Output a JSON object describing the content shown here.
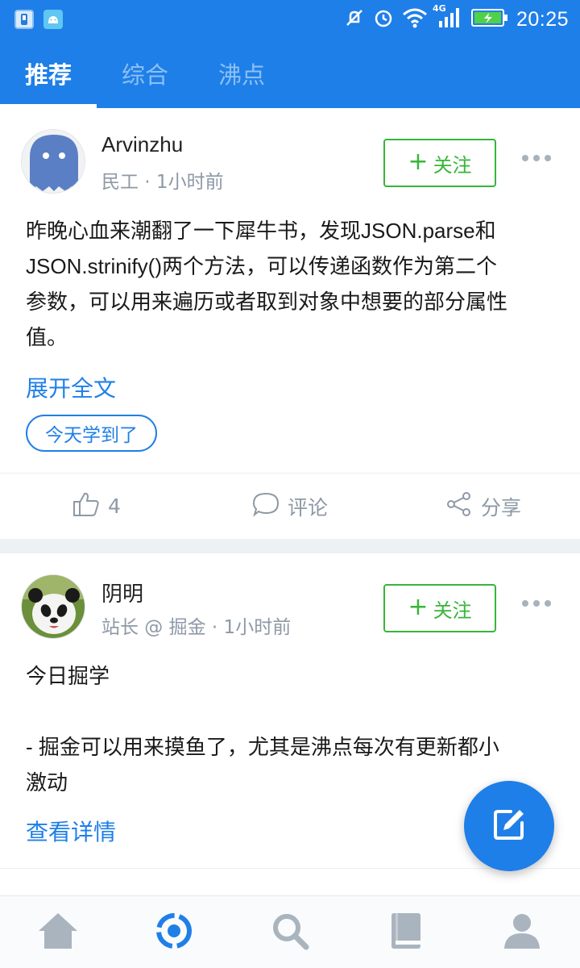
{
  "status_bar": {
    "time": "20:25",
    "network": "4G",
    "icons": [
      "app-icon",
      "android-icon",
      "silent-icon",
      "alarm-icon",
      "wifi-icon",
      "signal-icon",
      "battery-icon"
    ]
  },
  "tabs": [
    {
      "label": "推荐",
      "active": true
    },
    {
      "label": "综合",
      "active": false
    },
    {
      "label": "沸点",
      "active": false
    }
  ],
  "posts": [
    {
      "author": "Arvinzhu",
      "meta": "民工 · 1小时前",
      "follow_label": "关注",
      "content_lines": [
        "昨晚心血来潮翻了一下犀牛书，发现JSON.parse和",
        "JSON.strinify()两个方法，可以传递函数作为第二个",
        "参数，可以用来遍历或者取到对象中想要的部分属性",
        "值。"
      ],
      "expand_label": "展开全文",
      "topic": "今天学到了",
      "likes": "4",
      "comment_label": "评论",
      "share_label": "分享"
    },
    {
      "author": "阴明",
      "meta": "站长 @ 掘金 · 1小时前",
      "follow_label": "关注",
      "content_lines": [
        "今日掘学",
        "",
        "- 掘金可以用来摸鱼了，尤其是沸点每次有更新都小",
        "激动"
      ],
      "expand_label": "查看详情"
    }
  ],
  "bottom_nav": [
    "home-icon",
    "pins-icon",
    "search-icon",
    "book-icon",
    "profile-icon"
  ],
  "colors": {
    "brand_blue": "#1f7fe8",
    "follow_green": "#37b53a",
    "meta_gray": "#8d99a6"
  }
}
